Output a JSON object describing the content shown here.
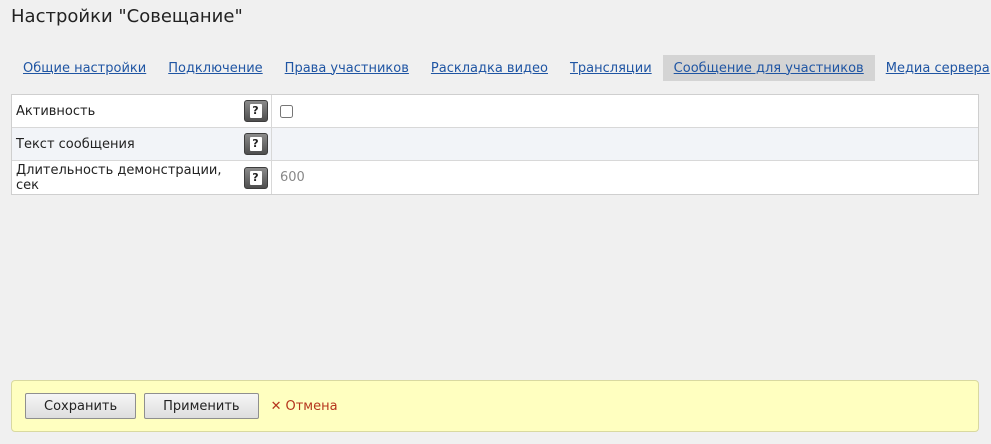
{
  "page": {
    "title": "Настройки \"Совещание\""
  },
  "tabs": [
    {
      "label": "Общие настройки",
      "active": false
    },
    {
      "label": "Подключение",
      "active": false
    },
    {
      "label": "Права участников",
      "active": false
    },
    {
      "label": "Раскладка видео",
      "active": false
    },
    {
      "label": "Трансляции",
      "active": false
    },
    {
      "label": "Сообщение для участников",
      "active": true
    },
    {
      "label": "Медиа сервера",
      "active": false
    }
  ],
  "settings": {
    "activity": {
      "label": "Активность",
      "checked": false
    },
    "message_text": {
      "label": "Текст сообщения",
      "value": ""
    },
    "duration": {
      "label": "Длительность демонстрации, сек",
      "placeholder": "600"
    }
  },
  "help_icon": {
    "name": "help-icon",
    "glyph": "?"
  },
  "footer": {
    "save_label": "Сохранить",
    "apply_label": "Применить",
    "cancel_icon": "✕",
    "cancel_label": "Отмена"
  },
  "colors": {
    "link": "#1f55a3",
    "active_tab_bg": "#d4d4d4",
    "footer_bg": "#ffffc0",
    "cancel": "#b5351d"
  }
}
